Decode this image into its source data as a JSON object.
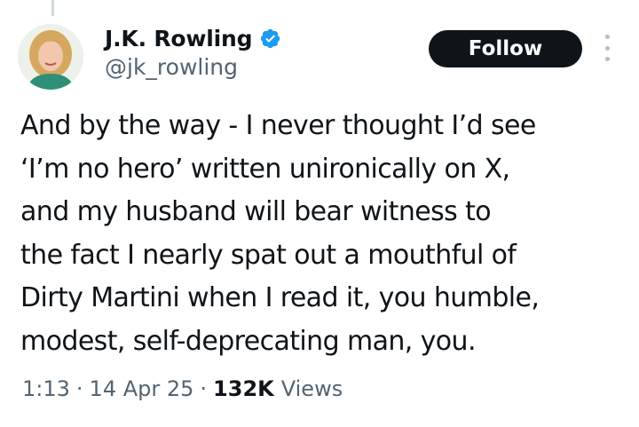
{
  "author": {
    "display_name": "J.K. Rowling",
    "handle": "@jk_rowling",
    "verified": true
  },
  "actions": {
    "follow_label": "Follow"
  },
  "tweet": {
    "text": "And by the way - I never thought I’d see\n‘I’m no hero’ written unironically on X,\nand my husband will bear witness to\nthe fact I nearly spat out a mouthful of\nDirty Martini when I read it, you humble,\nmodest, self-deprecating man, you.",
    "time": "1:13",
    "separator": "·",
    "date": "14 Apr 25",
    "views_count": "132K",
    "views_label": "Views"
  },
  "colors": {
    "text": "#0f1419",
    "secondary": "#536471",
    "verified": "#1d9bf0",
    "button_bg": "#0f1419",
    "button_text": "#ffffff"
  },
  "icons": {
    "verified": "verified-badge-icon",
    "more": "more-options-icon"
  }
}
